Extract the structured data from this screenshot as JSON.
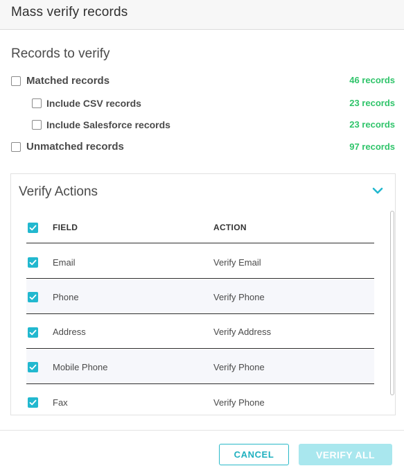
{
  "dialog": {
    "title": "Mass verify records"
  },
  "records_section": {
    "title": "Records to verify",
    "items": [
      {
        "label": "Matched records",
        "count": "46 records",
        "checked": false
      },
      {
        "label": "Include CSV records",
        "count": "23 records",
        "checked": false
      },
      {
        "label": "Include Salesforce records",
        "count": "23 records",
        "checked": false
      },
      {
        "label": "Unmatched records",
        "count": "97 records",
        "checked": false
      }
    ]
  },
  "verify_actions": {
    "title": "Verify Actions",
    "expand_icon": "chevron-down-icon",
    "columns": {
      "field": "FIELD",
      "action": "ACTION"
    },
    "rows": [
      {
        "field": "Email",
        "action": "Verify Email",
        "checked": true
      },
      {
        "field": "Phone",
        "action": "Verify Phone",
        "checked": true
      },
      {
        "field": "Address",
        "action": "Verify Address",
        "checked": true
      },
      {
        "field": "Mobile Phone",
        "action": "Verify Phone",
        "checked": true
      },
      {
        "field": "Fax",
        "action": "Verify Phone",
        "checked": true
      }
    ]
  },
  "footer": {
    "cancel_label": "CANCEL",
    "verify_all_label": "VERIFY ALL"
  },
  "colors": {
    "accent": "#22b8cf",
    "count_green": "#2fc46a",
    "verify_disabled": "#a9e7ee"
  }
}
